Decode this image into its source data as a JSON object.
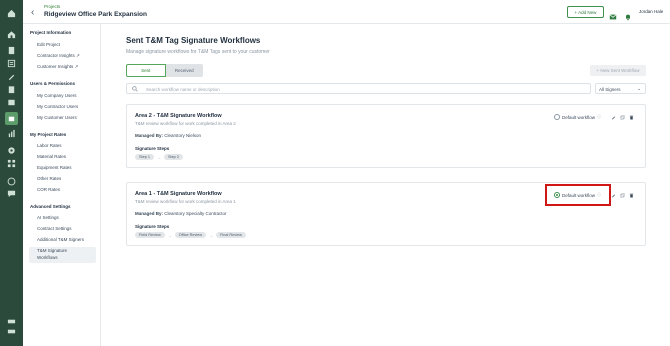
{
  "header": {
    "breadcrumb": "Projects",
    "project_title": "Ridgeview Office Park Expansion",
    "add_new": "+ Add New",
    "user_name": "Jordan Hale"
  },
  "leftnav": {
    "sections": [
      {
        "title": "Project Information",
        "items": [
          "Edit Project",
          "Contractor Insights",
          "Customer Insights"
        ]
      },
      {
        "title": "Users & Permissions",
        "items": [
          "My Company Users",
          "My Contractor Users",
          "My Customer Users"
        ]
      },
      {
        "title": "My Project Rates",
        "items": [
          "Labor Rates",
          "Material Rates",
          "Equipment Rates",
          "Other Rates",
          "COR Rates"
        ]
      },
      {
        "title": "Advanced Settings",
        "items": [
          "AI Settings",
          "Contract Settings",
          "Additional T&M Signers"
        ]
      }
    ],
    "active_item_line1": "T&M Signature",
    "active_item_line2": "Workflows"
  },
  "main": {
    "title": "Sent T&M Tag Signature Workflows",
    "subtitle": "Manage signature workflows for T&M Tags sent to your customer",
    "tabs": [
      "Sent",
      "Received"
    ],
    "new_workflow": "+ New Sent Workflow",
    "search_placeholder": "Search workflow name or description",
    "signers_filter": "All Signers",
    "signers_chevron": "⌄"
  },
  "workflows": [
    {
      "title": "Area 2 - T&M Signature Workflow",
      "description": "T&M review workflow for work completed in Area 2",
      "managed_label": "Managed By:",
      "managed_value": "Clearstory Nielson",
      "steps_heading": "Signature Steps",
      "steps": [
        "Step 1",
        "Step 2"
      ],
      "default_label": "Default workflow",
      "is_default": false
    },
    {
      "title": "Area 1 - T&M Signature Workflow",
      "description": "T&M review workflow for work completed in Area 1",
      "managed_label": "Managed By:",
      "managed_value": "Clearstory Specialty Contractor",
      "steps_heading": "Signature Steps",
      "steps": [
        "Field Review",
        "Office Review",
        "Final Review"
      ],
      "default_label": "Default workflow",
      "is_default": true
    }
  ],
  "glyphs": {
    "back": "‹",
    "arrow": "→",
    "info": "ⓘ",
    "external": "↗"
  },
  "colors": {
    "rail": "#2b4a3c",
    "accent": "#3f8f4f",
    "highlight": "#d11616"
  },
  "rail_icons": [
    "home-icon",
    "document-icon",
    "list-icon",
    "pencil-icon",
    "clipboard-icon",
    "box-icon",
    "project-icon",
    "chart-icon",
    "gear-icon",
    "grid-icon",
    "help-icon",
    "chat-icon",
    "expand-icon",
    "collapse-icon"
  ]
}
